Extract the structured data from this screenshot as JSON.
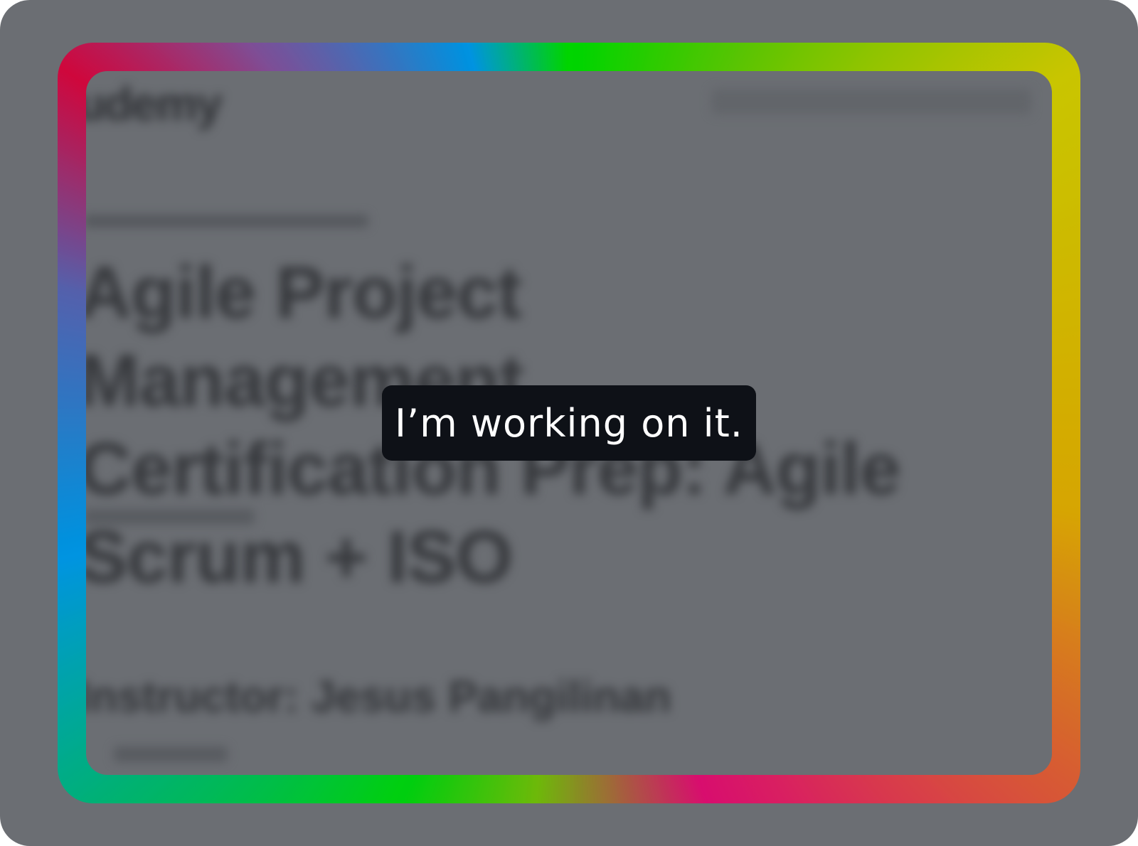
{
  "status": {
    "message": "I’m working on it."
  },
  "background": {
    "logo": "udemy",
    "title": "Agile Project Management Certification Prep: Agile Scrum + ISO",
    "instructor_heading": "Instructor: Jesus Pangilinan"
  },
  "colors": {
    "backdrop": "#6b6e73",
    "toast_bg": "#0e1117",
    "toast_text": "#ffffff"
  }
}
